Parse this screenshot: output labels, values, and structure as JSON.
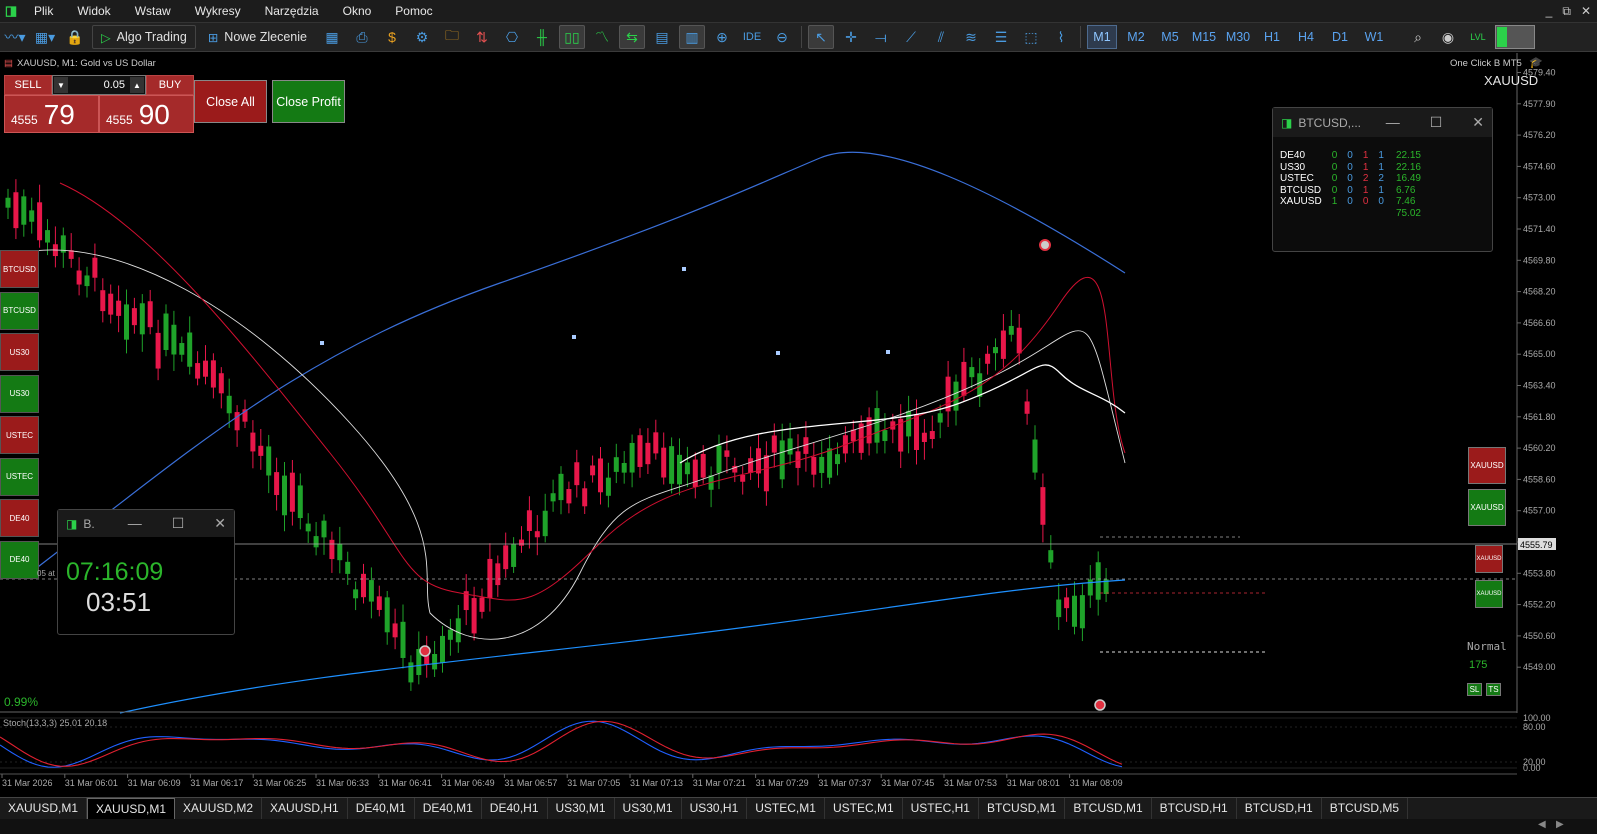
{
  "menu": {
    "items": [
      "Plik",
      "Widok",
      "Wstaw",
      "Wykresy",
      "Narzędzia",
      "Okno",
      "Pomoc"
    ]
  },
  "toolbar": {
    "algo_trading": "Algo Trading",
    "new_order": "Nowe Zlecenie",
    "ide": "IDE",
    "timeframes": [
      "M1",
      "M2",
      "M5",
      "M15",
      "M30",
      "H1",
      "H4",
      "D1",
      "W1"
    ],
    "active_timeframe": "M1"
  },
  "chart": {
    "title": "XAUUSD, M1:  Gold vs US Dollar",
    "oneclick": "One Click B MT5",
    "symbol": "XAUUSD",
    "percent": "0.99%",
    "normal_label": "Normal",
    "normal_value": "175",
    "current_price": "4555.79",
    "stoch_label": "Stoch(13,3,3) 25.01 20.18",
    "left_text": "05 at"
  },
  "trade_panel": {
    "sell": "SELL",
    "buy": "BUY",
    "qty": "0.05",
    "bid_small": "4555",
    "bid_big": "79",
    "ask_small": "4555",
    "ask_big": "90",
    "close_all": "Close All",
    "close_profit": "Close Profit"
  },
  "side_buttons": [
    {
      "label": "BTCUSD",
      "color": "#9b1b1b"
    },
    {
      "label": "BTCUSD",
      "color": "#147a14"
    },
    {
      "label": "US30",
      "color": "#9b1b1b"
    },
    {
      "label": "US30",
      "color": "#147a14"
    },
    {
      "label": "USTEC",
      "color": "#9b1b1b"
    },
    {
      "label": "USTEC",
      "color": "#147a14"
    },
    {
      "label": "DE40",
      "color": "#9b1b1b"
    },
    {
      "label": "DE40",
      "color": "#147a14"
    }
  ],
  "right_buttons": {
    "xau_sell": "XAUUSD",
    "xau_buy": "XAUUSD",
    "small_sell": "XAUUSD",
    "small_buy": "XAUUSD",
    "sl": "SL",
    "ts": "TS"
  },
  "clock": {
    "title": "B.",
    "time": "07:16:09",
    "countdown": "03:51"
  },
  "btc_window": {
    "title": "BTCUSD,...",
    "rows": [
      {
        "sym": "DE40",
        "a": "0",
        "b": "0",
        "c": "1",
        "d": "1",
        "v": "22.15"
      },
      {
        "sym": "US30",
        "a": "0",
        "b": "0",
        "c": "1",
        "d": "1",
        "v": "22.16"
      },
      {
        "sym": "USTEC",
        "a": "0",
        "b": "0",
        "c": "2",
        "d": "2",
        "v": "16.49"
      },
      {
        "sym": "BTCUSD",
        "a": "0",
        "b": "0",
        "c": "1",
        "d": "1",
        "v": "6.76"
      },
      {
        "sym": "XAUUSD",
        "a": "1",
        "b": "0",
        "c": "0",
        "d": "0",
        "v": "7.46"
      }
    ],
    "total": "75.02"
  },
  "price_axis": [
    "4579.40",
    "4577.90",
    "4576.20",
    "4574.60",
    "4573.00",
    "4571.40",
    "4569.80",
    "4568.20",
    "4566.60",
    "4565.00",
    "4563.40",
    "4561.80",
    "4560.20",
    "4558.60",
    "4557.00",
    "4555.40",
    "4553.80",
    "4552.20",
    "4550.60",
    "4549.00"
  ],
  "stoch_axis": [
    "100.00",
    "80.00",
    "20.00",
    "0.00"
  ],
  "time_axis": [
    "31 Mar 2026",
    "31 Mar 06:01",
    "31 Mar 06:09",
    "31 Mar 06:17",
    "31 Mar 06:25",
    "31 Mar 06:33",
    "31 Mar 06:41",
    "31 Mar 06:49",
    "31 Mar 06:57",
    "31 Mar 07:05",
    "31 Mar 07:13",
    "31 Mar 07:21",
    "31 Mar 07:29",
    "31 Mar 07:37",
    "31 Mar 07:45",
    "31 Mar 07:53",
    "31 Mar 08:01",
    "31 Mar 08:09"
  ],
  "tabs": [
    "XAUUSD,M1",
    "XAUUSD,M1",
    "XAUUSD,M2",
    "XAUUSD,H1",
    "DE40,M1",
    "DE40,M1",
    "DE40,H1",
    "US30,M1",
    "US30,M1",
    "US30,H1",
    "USTEC,M1",
    "USTEC,M1",
    "USTEC,H1",
    "BTCUSD,M1",
    "BTCUSD,M1",
    "BTCUSD,H1",
    "BTCUSD,H1",
    "BTCUSD,M5"
  ],
  "active_tab": 1
}
